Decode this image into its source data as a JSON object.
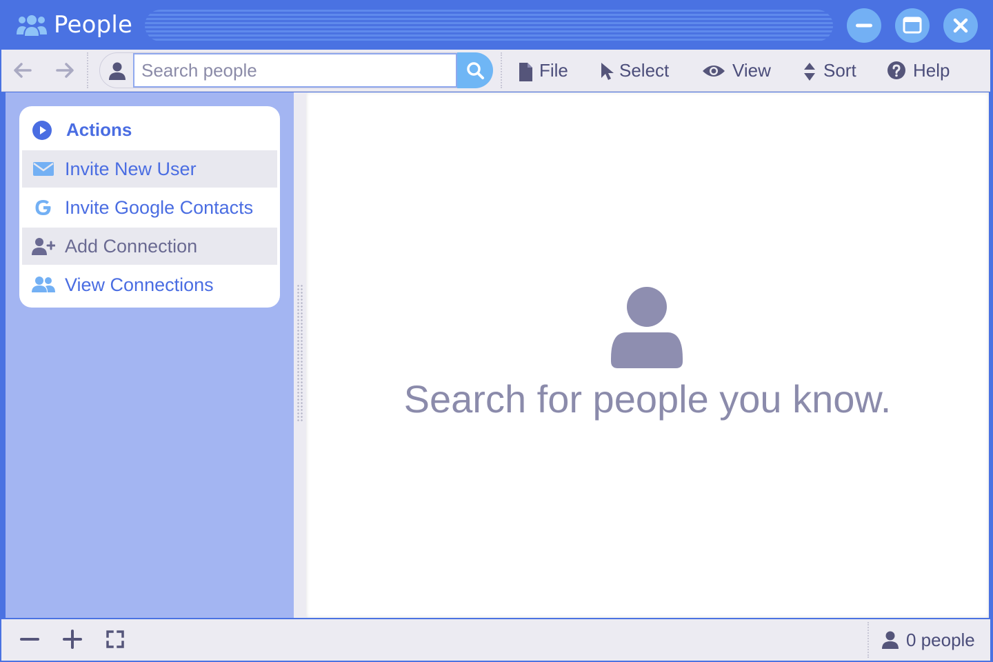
{
  "window": {
    "title": "People",
    "title_icon": "users-icon",
    "controls": [
      "minimize-icon",
      "maximize-icon",
      "close-icon"
    ]
  },
  "toolbar": {
    "back_icon": "arrow-left-icon",
    "forward_icon": "arrow-right-icon",
    "search": {
      "placeholder": "Search people",
      "value": "",
      "icon": "search-icon"
    },
    "menus": [
      {
        "label": "File",
        "icon": "file-icon"
      },
      {
        "label": "Select",
        "icon": "pointer-icon"
      },
      {
        "label": "View",
        "icon": "eye-icon"
      },
      {
        "label": "Sort",
        "icon": "sort-icon"
      },
      {
        "label": "Help",
        "icon": "question-circle-icon"
      }
    ]
  },
  "sidebar": {
    "header": {
      "label": "Actions",
      "icon": "play-circle-icon"
    },
    "items": [
      {
        "label": "Invite New User",
        "icon": "envelope-icon"
      },
      {
        "label": "Invite Google Contacts",
        "icon": "google-icon"
      },
      {
        "label": "Add Connection",
        "icon": "user-plus-icon"
      },
      {
        "label": "View Connections",
        "icon": "users-icon"
      }
    ]
  },
  "main": {
    "empty_icon": "user-icon",
    "empty_message": "Search for people you know."
  },
  "statusbar": {
    "zoom_out_icon": "minus-icon",
    "zoom_in_icon": "plus-icon",
    "fit_icon": "expand-icon",
    "people_count": "0 people"
  },
  "colors": {
    "brand": "#4a72e2",
    "accent_light": "#73b0f4",
    "sidebar": "#a3b5f2",
    "text_link": "#4a6de2",
    "text_muted": "#8b8bab",
    "toolbar_bg": "#ecebf2"
  }
}
